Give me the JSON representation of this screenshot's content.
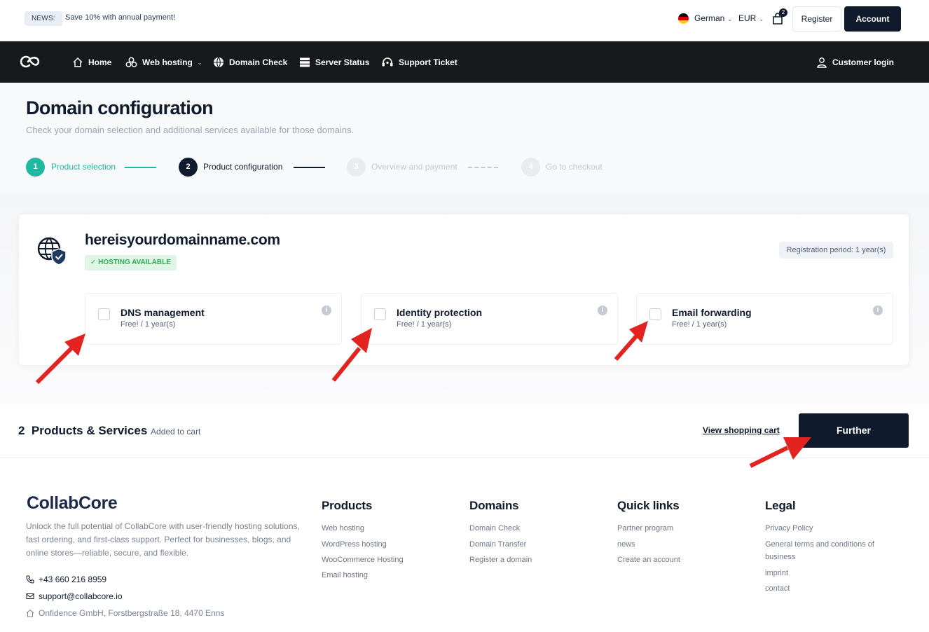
{
  "topbar": {
    "news_tag": "NEWS:",
    "news_text": "Save 10% with annual payment!",
    "language": "German",
    "currency": "EUR",
    "cart_count": "2",
    "register_label": "Register",
    "account_label": "Account"
  },
  "nav": {
    "items": [
      {
        "label": "Home",
        "icon": "home-icon"
      },
      {
        "label": "Web hosting",
        "icon": "cubes-icon"
      },
      {
        "label": "Domain Check",
        "icon": "globe-icon"
      },
      {
        "label": "Server Status",
        "icon": "server-icon"
      },
      {
        "label": "Support Ticket",
        "icon": "headset-icon"
      }
    ],
    "customer_login": "Customer login"
  },
  "page": {
    "title": "Domain configuration",
    "subtitle": "Check your domain selection and additional services available for those domains."
  },
  "steps": [
    {
      "num": "1",
      "label": "Product selection",
      "state": "done"
    },
    {
      "num": "2",
      "label": "Product configuration",
      "state": "active"
    },
    {
      "num": "3",
      "label": "Overview and payment",
      "state": "pending"
    },
    {
      "num": "4",
      "label": "Go to checkout",
      "state": "pending"
    }
  ],
  "domain": {
    "name": "hereisyourdomainname.com",
    "hosting_badge": "HOSTING AVAILABLE",
    "registration_period": "Registration period: 1 year(s)",
    "options": [
      {
        "title": "DNS management",
        "price": "Free! / 1 year(s)",
        "checked": false
      },
      {
        "title": "Identity protection",
        "price": "Free! / 1 year(s)",
        "checked": false
      },
      {
        "title": "Email forwarding",
        "price": "Free! / 1 year(s)",
        "checked": false
      }
    ]
  },
  "cartbar": {
    "count": "2",
    "label": "Products & Services",
    "added": "Added to cart",
    "view_cart": "View shopping cart",
    "further": "Further"
  },
  "footer": {
    "brand": "CollabCore",
    "description": "Unlock the full potential of CollabCore with user-friendly hosting solutions, fast ordering, and first-class support. Perfect for businesses, blogs, and online stores—reliable, secure, and flexible.",
    "phone": "+43 660 216 8959",
    "email": "support@collabcore.io",
    "address": "Onfidence GmbH, Forstbergstraße 18, 4470 Enns",
    "columns": [
      {
        "heading": "Products",
        "links": [
          "Web hosting",
          "WordPress hosting",
          "WooCommerce Hosting",
          "Email hosting"
        ]
      },
      {
        "heading": "Domains",
        "links": [
          "Domain Check",
          "Domain Transfer",
          "Register a domain"
        ]
      },
      {
        "heading": "Quick links",
        "links": [
          "Partner program",
          "news",
          "Create an account"
        ]
      },
      {
        "heading": "Legal",
        "links": [
          "Privacy Policy",
          "General terms and conditions of business",
          "imprint",
          "contact"
        ]
      }
    ]
  },
  "colors": {
    "navy": "#0f1b2d",
    "nav_bg": "#17191c",
    "teal": "#1fb8a0",
    "annotation_red": "#e3231f"
  }
}
